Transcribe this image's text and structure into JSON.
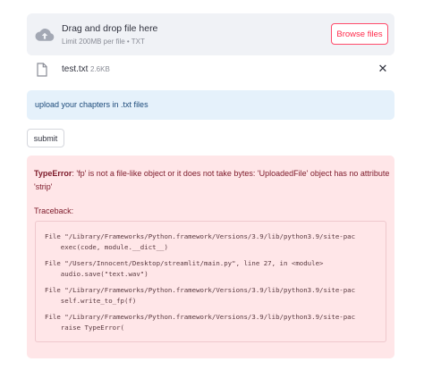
{
  "uploader": {
    "title": "Drag and drop file here",
    "subtitle": "Limit 200MB per file • TXT",
    "browse_label": "Browse files",
    "icon": "cloud-upload-icon"
  },
  "file": {
    "name": "test.txt",
    "size": "2.6KB",
    "icon": "file-icon",
    "remove_icon": "close-icon",
    "remove_label": "✕"
  },
  "info": {
    "text": "upload your chapters in .txt files"
  },
  "submit": {
    "label": "submit"
  },
  "error": {
    "type": "TypeError",
    "message": ": 'fp' is not a file-like object or it does not take bytes: 'UploadedFile' object has no attribute 'strip'",
    "traceback_label": "Traceback:",
    "lines": [
      "File \"/Library/Frameworks/Python.framework/Versions/3.9/lib/python3.9/site-pac",
      "    exec(code, module.__dict__)",
      "File \"/Users/Innocent/Desktop/streamlit/main.py\", line 27, in <module>",
      "    audio.save(\"text.wav\")",
      "File \"/Library/Frameworks/Python.framework/Versions/3.9/lib/python3.9/site-pac",
      "    self.write_to_fp(f)",
      "File \"/Library/Frameworks/Python.framework/Versions/3.9/lib/python3.9/site-pac",
      "    raise TypeError("
    ]
  },
  "colors": {
    "accent": "#ff4b4b",
    "info_bg": "#e5f1fb",
    "error_bg": "#ffe6e8",
    "uploader_bg": "#f0f2f6"
  }
}
